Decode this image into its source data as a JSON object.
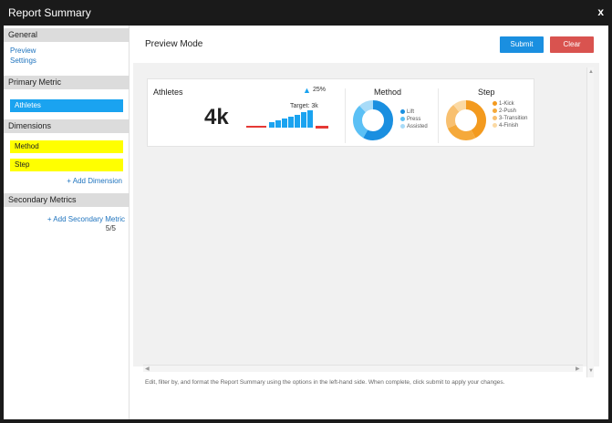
{
  "window": {
    "title": "Report Summary",
    "close_label": "x"
  },
  "sidebar": {
    "general": {
      "header": "General",
      "links": [
        "Preview",
        "Settings"
      ]
    },
    "primary_metric": {
      "header": "Primary Metric",
      "chip": "Athletes"
    },
    "dimensions": {
      "header": "Dimensions",
      "chips": [
        "Method",
        "Step"
      ],
      "add_label": "+ Add Dimension"
    },
    "secondary_metrics": {
      "header": "Secondary Metrics",
      "add_label": "+ Add Secondary Metric",
      "add_label_2": "5/5"
    }
  },
  "main": {
    "title": "Preview Mode",
    "submit_label": "Submit",
    "clear_label": "Clear",
    "footnote": "Edit, filter by, and format the Report Summary using the options in the left-hand side. When complete, click submit to apply your changes."
  },
  "card": {
    "metric": {
      "title": "Athletes",
      "value": "4k",
      "delta": "25%",
      "delta_label": "Target: 3k"
    },
    "method": {
      "title": "Method",
      "legend": [
        "Lift",
        "Press",
        "Assisted"
      ]
    },
    "step": {
      "title": "Step",
      "legend": [
        "1-Kick",
        "2-Push",
        "3-Transition",
        "4-Finish"
      ]
    }
  },
  "colors": {
    "accent_blue": "#1aa3f0",
    "accent_orange": "#f39a1e",
    "accent_yellow": "#ffff00",
    "clear_red": "#d9534f",
    "titlebar": "#1a1a1a"
  }
}
